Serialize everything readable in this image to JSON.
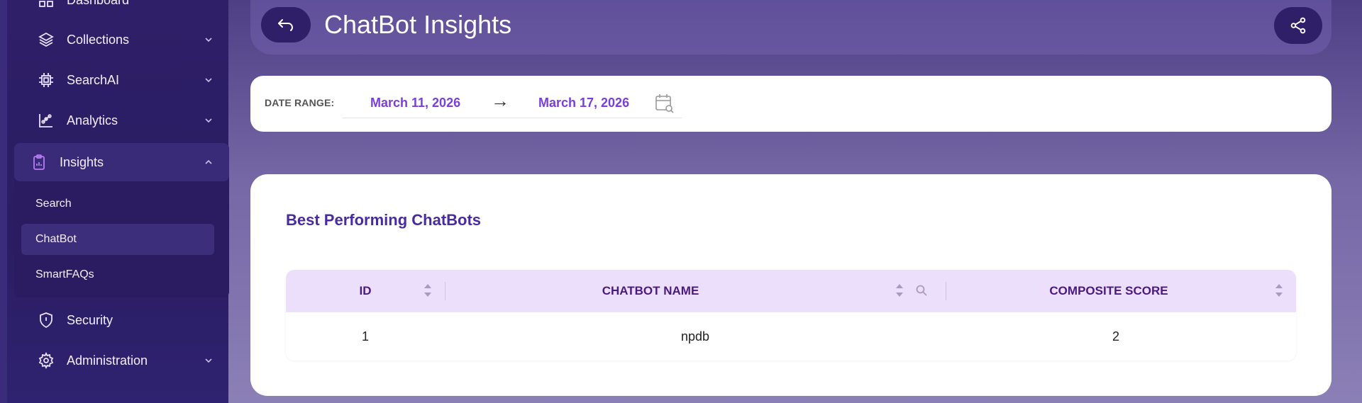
{
  "sidebar": {
    "items": [
      {
        "label": "Dashboard"
      },
      {
        "label": "Collections"
      },
      {
        "label": "SearchAI"
      },
      {
        "label": "Analytics"
      },
      {
        "label": "Insights"
      },
      {
        "label": "Security"
      },
      {
        "label": "Administration"
      }
    ],
    "insights_sub": [
      {
        "label": "Search"
      },
      {
        "label": "ChatBot"
      },
      {
        "label": "SmartFAQs"
      }
    ]
  },
  "header": {
    "title": "ChatBot Insights"
  },
  "date_range": {
    "label": "DATE RANGE:",
    "start": "March 11, 2026",
    "arrow": "→",
    "end": "March 17, 2026"
  },
  "table_card": {
    "title": "Best Performing ChatBots",
    "columns": [
      "ID",
      "CHATBOT NAME",
      "COMPOSITE SCORE"
    ],
    "rows": [
      {
        "id": "1",
        "name": "npdb",
        "score": "2"
      }
    ]
  },
  "colors": {
    "accent": "#7a3fdb",
    "sidebar_bg": "#2e1f68",
    "header_bg": "#ecdffc"
  }
}
